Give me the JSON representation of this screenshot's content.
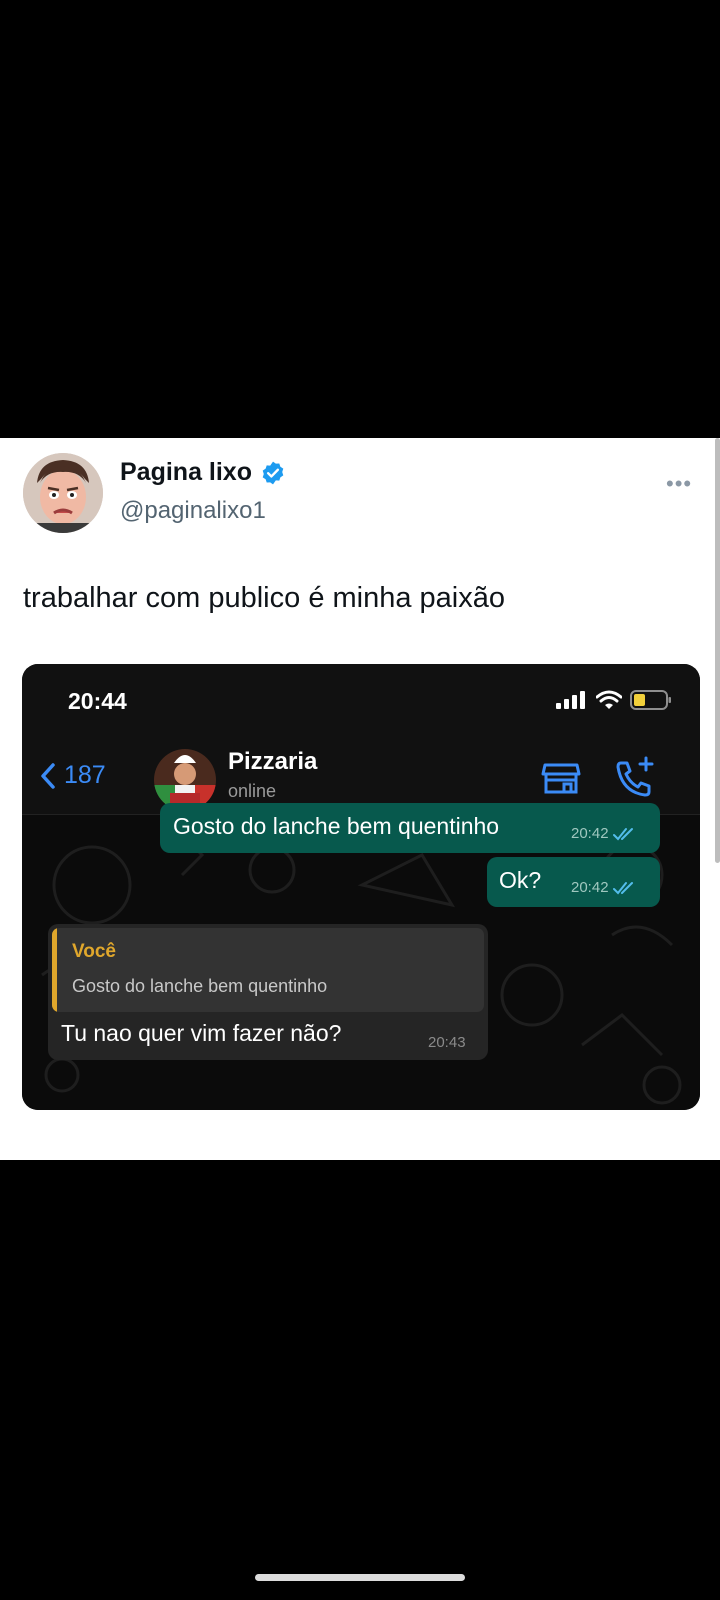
{
  "tweet": {
    "author_name": "Pagina lixo",
    "handle": "@paginalixo1",
    "verified": true,
    "text": "trabalhar com publico é minha paixão",
    "more_icon": "more-horizontal-icon"
  },
  "phone": {
    "status_time": "20:44",
    "back_count": "187",
    "contact_name": "Pizzaria",
    "contact_status": "online",
    "icons": [
      "signal-icon",
      "wifi-icon",
      "battery-icon",
      "store-icon",
      "call-add-icon"
    ]
  },
  "messages": [
    {
      "direction": "out",
      "text": "Gosto do lanche bem quentinho",
      "time": "20:42"
    },
    {
      "direction": "out",
      "text": "Ok?",
      "time": "20:42"
    },
    {
      "direction": "in",
      "quote_author": "Você",
      "quote_text": "Gosto do lanche bem quentinho",
      "text": "Tu nao quer vim fazer não?",
      "time": "20:43"
    }
  ],
  "colors": {
    "verified_blue": "#1d9bf0",
    "outgoing_bubble": "#07594d",
    "incoming_bubble": "#252525",
    "quote_accent": "#e0a72c",
    "link_blue": "#3b8bf6"
  }
}
